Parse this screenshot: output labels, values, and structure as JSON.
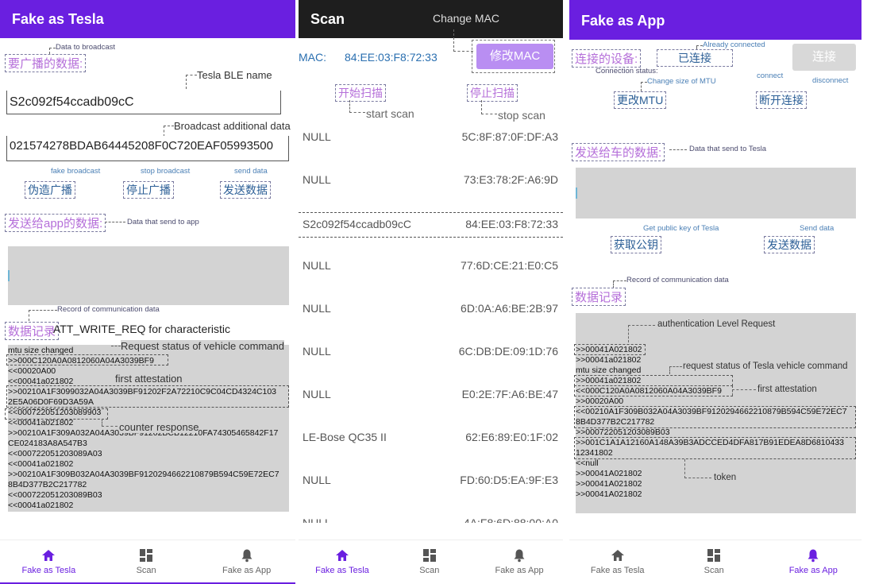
{
  "panel1": {
    "title": "Fake as Tesla",
    "data_to_broadcast_label": "要广播的数据:",
    "data_to_broadcast_ann": "Data to broadcast",
    "ble_name_ann": "Tesla BLE name",
    "ble_name_value": "S2c092f54ccadb09cC",
    "broadcast_additional_ann": "Broadcast additional data",
    "broadcast_additional_value": "021574278BDAB64445208F0C720EAF05993500",
    "fake_broadcast_ann": "fake broadcast",
    "stop_broadcast_ann": "stop broadcast",
    "send_data_ann": "send data",
    "fake_broadcast_btn": "伪造广播",
    "stop_broadcast_btn": "停止广播",
    "send_data_btn": "发送数据",
    "send_to_app_label": "发送给app的数据:",
    "send_to_app_ann": "Data that send to app",
    "record_ann": "Record of communication data",
    "record_label": "数据记录",
    "att_write": "ATT_WRITE_REQ for characteristic",
    "request_status_ann": "Request status of vehicle command",
    "first_attestation_ann": "first attestation",
    "counter_response_ann": "counter response",
    "log": [
      "mtu size changed",
      ">>000C120A0A0812060A04A3039BF9",
      "<<00020A00",
      "<<00041a021802",
      ">>00210A1F3099032A04A3039BF91202F2A72210C9C04CD4324C103",
      "2E5A06D0F69D3A59A",
      "<<000722051203089903",
      "<<00041a021802",
      ">>00210A1F309A032A04A3039BF91202BCB12210FA74305465842F17",
      "CE024183A8A547B3",
      "<<000722051203089A03",
      "<<00041a021802",
      ">>00210A1F309B032A04A3039BF9120294662210879B594C59E72EC7",
      "8B4D377B2C217782",
      "<<000722051203089B03",
      "<<00041a021802"
    ]
  },
  "panel2": {
    "title": "Scan",
    "change_mac_ann": "Change MAC",
    "mac_label": "MAC:",
    "mac_value": "84:EE:03:F8:72:33",
    "change_mac_btn": "修改MAC",
    "start_scan_btn": "开始扫描",
    "stop_scan_btn": "停止扫描",
    "start_scan_ann": "start scan",
    "stop_scan_ann": "stop scan",
    "devices": [
      {
        "name": "NULL",
        "mac": "5C:8F:87:0F:DF:A3"
      },
      {
        "name": "NULL",
        "mac": "73:E3:78:2F:A6:9D"
      },
      {
        "name": "S2c092f54ccadb09cC",
        "mac": "84:EE:03:F8:72:33"
      },
      {
        "name": "NULL",
        "mac": "77:6D:CE:21:E0:C5"
      },
      {
        "name": "NULL",
        "mac": "6D:0A:A6:BE:2B:97"
      },
      {
        "name": "NULL",
        "mac": "6C:DB:DE:09:1D:76"
      },
      {
        "name": "NULL",
        "mac": "E0:2E:7F:A6:BE:47"
      },
      {
        "name": "LE-Bose QC35 II",
        "mac": "62:E6:89:E0:1F:02"
      },
      {
        "name": "NULL",
        "mac": "FD:60:D5:EA:9F:E3"
      },
      {
        "name": "NULL",
        "mac": "4A:F8:6D:88:00:A0"
      }
    ]
  },
  "panel3": {
    "title": "Fake as App",
    "connected_label": "连接的设备:",
    "already_connected_ann": "Already connected",
    "already_connected_value": "已连接",
    "connect_btn": "连接",
    "connection_status_ann": "Connection status:",
    "connect_ann": "connect",
    "disconnect_ann": "disconnect",
    "change_mtu_ann": "Change size of MTU",
    "change_mtu_btn": "更改MTU",
    "disconnect_btn": "断开连接",
    "send_to_car_label": "发送给车的数据:",
    "send_to_car_ann": "Data that send to Tesla",
    "get_key_ann": "Get public key of Tesla",
    "send_data_ann": "Send data",
    "get_key_btn": "获取公钥",
    "send_data_btn": "发送数据",
    "record_ann": "Record of communication data",
    "record_label": "数据记录",
    "auth_ann": "authentication Level Request",
    "req_status_ann": "request status of Tesla vehicle command",
    "first_att_ann": "first attestation",
    "token_ann": "token",
    "log": [
      ">>00041A021802",
      ">>00041a021802",
      "mtu size changed",
      ">>00041a021802",
      "<<000C120A0A0812060A04A3039BF9",
      ">>00020A00",
      "<<00210A1F309B032A04A3039BF9120294662210879B594C59E72EC7",
      "8B4D377B2C217782",
      ">>000722051203089B03",
      ">>001C1A1A12160A148A39B3ADCCED4DFA817B91EDEA8D6810433",
      "12341802",
      "<<null",
      ">>00041A021802",
      ">>00041A021802",
      ">>00041A021802"
    ]
  },
  "nav": {
    "fake_tesla": "Fake as Tesla",
    "scan": "Scan",
    "fake_app": "Fake as App"
  },
  "colors": {
    "app_bar": "#6a1fe0",
    "scan_bar": "#1e1e1e",
    "accent_purple": "#b56fd9",
    "mac_blue": "#2a6fb0",
    "log_bg": "#d3d3d3"
  }
}
